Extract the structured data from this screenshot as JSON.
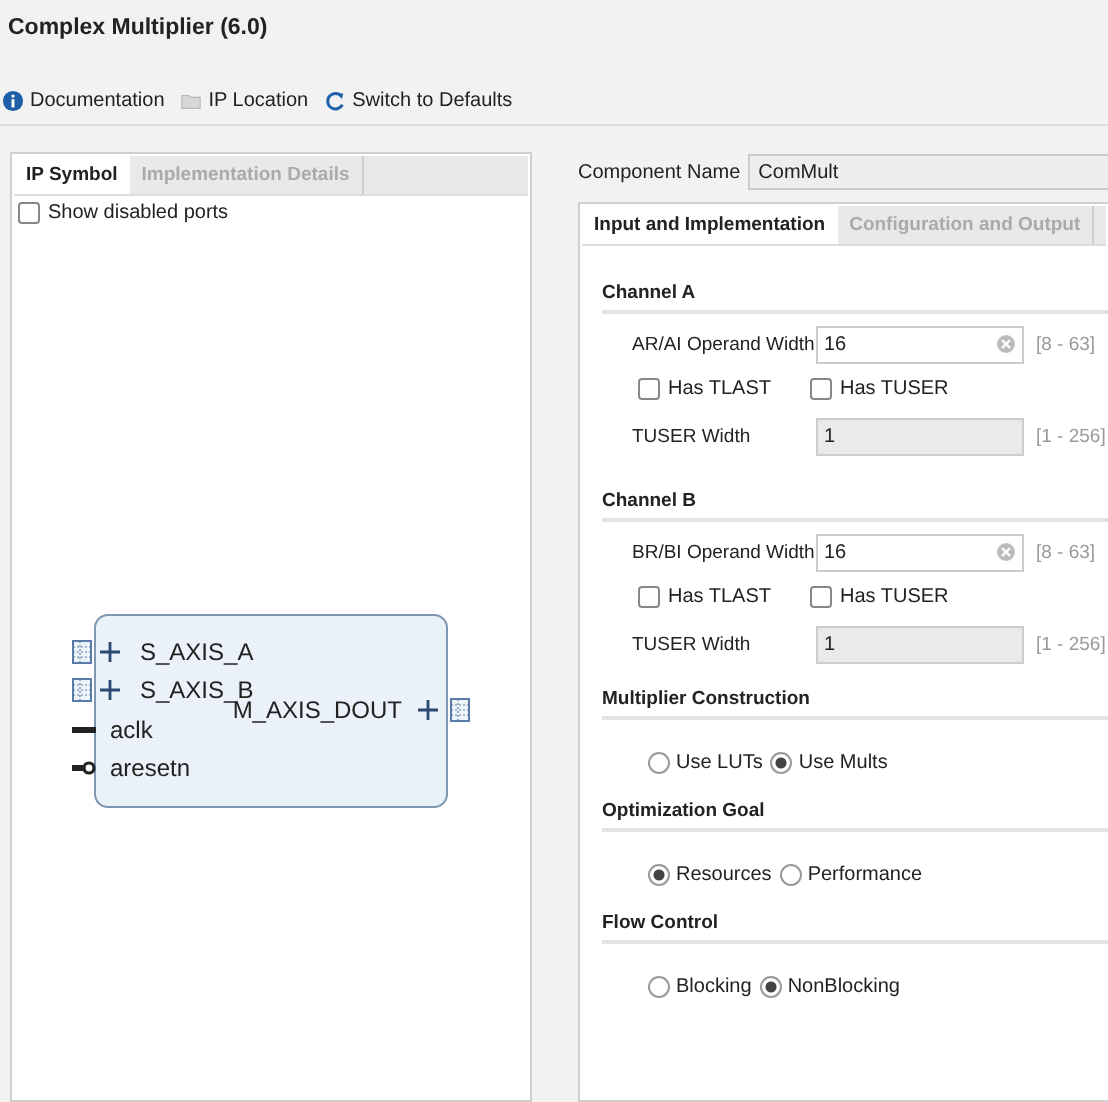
{
  "title": "Complex Multiplier (6.0)",
  "toolbar": [
    {
      "label": "Documentation",
      "kind": "info"
    },
    {
      "label": "IP Location",
      "kind": "folder"
    },
    {
      "label": "Switch to Defaults",
      "kind": "refresh"
    }
  ],
  "left_tabs": [
    {
      "label": "IP Symbol",
      "selected": true
    },
    {
      "label": "Implementation Details",
      "selected": false
    }
  ],
  "show_disabled_ports": {
    "label": "Show disabled ports",
    "checked": false
  },
  "symbol": {
    "ports_left": [
      {
        "name": "S_AXIS_A",
        "kind": "bus"
      },
      {
        "name": "S_AXIS_B",
        "kind": "bus"
      },
      {
        "name": "aclk",
        "kind": "wire"
      },
      {
        "name": "aresetn",
        "kind": "inverted"
      }
    ],
    "ports_right": [
      {
        "name": "M_AXIS_DOUT",
        "kind": "bus"
      }
    ]
  },
  "component_name": {
    "label": "Component Name",
    "value": "ComMult"
  },
  "right_tabs": [
    {
      "label": "Input and Implementation",
      "selected": true
    },
    {
      "label": "Configuration and Output",
      "selected": false
    }
  ],
  "sections": [
    {
      "title": "Channel A",
      "kind": "channel",
      "operand": {
        "label": "AR/AI Operand Width",
        "value": "16",
        "range": "[8 - 63]"
      },
      "checkboxes": [
        {
          "label": "Has TLAST",
          "checked": false
        },
        {
          "label": "Has TUSER",
          "checked": false
        }
      ],
      "tuser": {
        "label": "TUSER Width",
        "value": "1",
        "range": "[1 - 256]",
        "disabled": true
      }
    },
    {
      "title": "Channel B",
      "kind": "channel",
      "operand": {
        "label": "BR/BI Operand Width",
        "value": "16",
        "range": "[8 - 63]"
      },
      "checkboxes": [
        {
          "label": "Has TLAST",
          "checked": false
        },
        {
          "label": "Has TUSER",
          "checked": false
        }
      ],
      "tuser": {
        "label": "TUSER Width",
        "value": "1",
        "range": "[1 - 256]",
        "disabled": true
      }
    },
    {
      "title": "Multiplier Construction",
      "kind": "radio",
      "options": [
        {
          "label": "Use LUTs",
          "selected": false
        },
        {
          "label": "Use Mults",
          "selected": true
        }
      ]
    },
    {
      "title": "Optimization Goal",
      "kind": "radio",
      "options": [
        {
          "label": "Resources",
          "selected": true
        },
        {
          "label": "Performance",
          "selected": false
        }
      ]
    },
    {
      "title": "Flow Control",
      "kind": "radio",
      "options": [
        {
          "label": "Blocking",
          "selected": false
        },
        {
          "label": "NonBlocking",
          "selected": true
        }
      ]
    }
  ]
}
